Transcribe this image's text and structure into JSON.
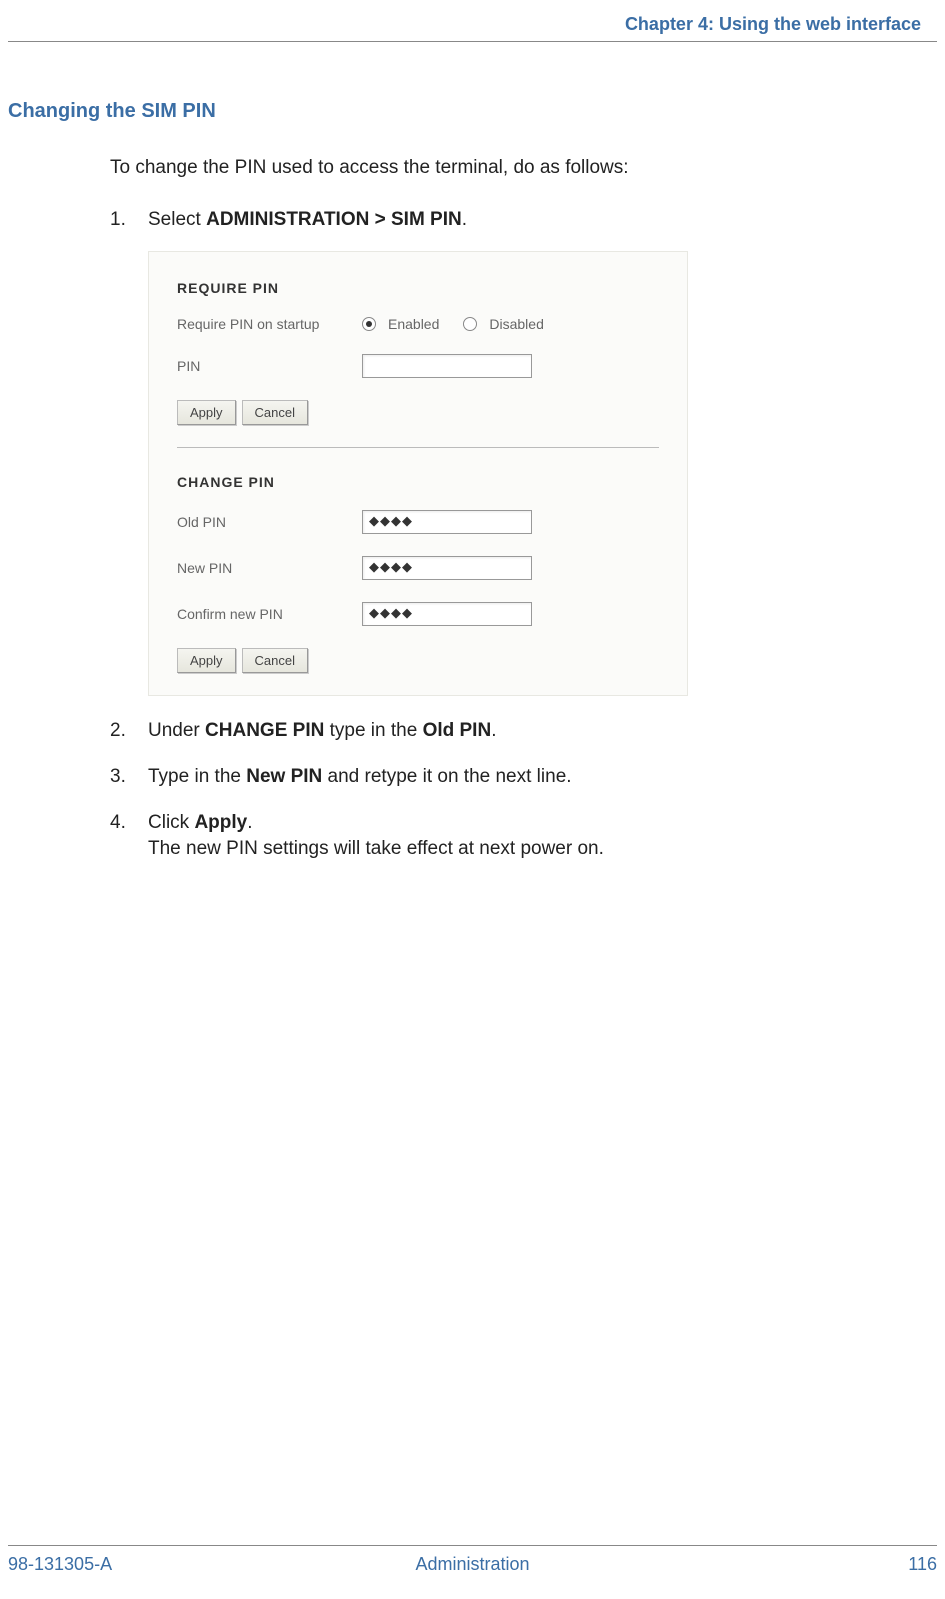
{
  "header": {
    "running_head": "Chapter 4: Using the web interface"
  },
  "section": {
    "heading": "Changing the SIM PIN",
    "intro": "To change the PIN used to access the terminal, do as follows:"
  },
  "steps": {
    "s1": {
      "num": "1.",
      "pre": "Select ",
      "bold": "ADMINISTRATION > SIM PIN",
      "post": "."
    },
    "s2": {
      "num": "2.",
      "pre": "Under ",
      "bold1": "CHANGE PIN",
      "mid": " type in the ",
      "bold2": "Old PIN",
      "post": "."
    },
    "s3": {
      "num": "3.",
      "pre": "Type in the ",
      "bold": "New PIN",
      "post": " and retype it on the next line."
    },
    "s4": {
      "num": "4.",
      "pre": "Click ",
      "bold": "Apply",
      "post": ".",
      "sub": "The new PIN settings will take effect at next power on."
    }
  },
  "screenshot": {
    "require_pin_title": "REQUIRE PIN",
    "require_label": "Require PIN on startup",
    "enabled_label": "Enabled",
    "disabled_label": "Disabled",
    "pin_label": "PIN",
    "apply_label": "Apply",
    "cancel_label": "Cancel",
    "change_pin_title": "CHANGE PIN",
    "old_pin_label": "Old PIN",
    "new_pin_label": "New PIN",
    "confirm_pin_label": "Confirm new PIN",
    "masked_value": "◆◆◆◆"
  },
  "footer": {
    "left": "98-131305-A",
    "center": "Administration",
    "right": "116"
  }
}
